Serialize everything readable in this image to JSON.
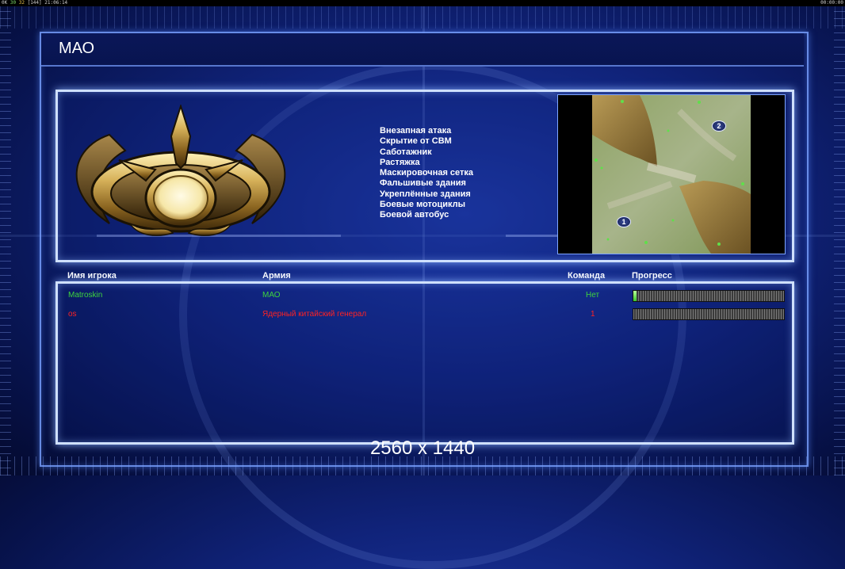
{
  "overlay": {
    "left_prefix": "0K",
    "left_green": "30",
    "left_yellow": "32",
    "left_gray": "[144]",
    "left_time": "21:06:14",
    "right_time": "00:00:00"
  },
  "header": {
    "title": "МАО"
  },
  "general": {
    "emblem": "gold-crest-emblem",
    "abilities": [
      "Внезапная атака",
      "Скрытие от СВМ",
      "Саботажник",
      "Растяжка",
      "Маскировочная сетка",
      "Фальшивые здания",
      "Укреплённые здания",
      "Боевые мотоциклы",
      "Боевой автобус"
    ]
  },
  "minimap": {
    "spawns": [
      {
        "label": "2"
      },
      {
        "label": "1"
      }
    ]
  },
  "table": {
    "headers": {
      "player": "Имя игрока",
      "army": "Армия",
      "team": "Команда",
      "progress": "Прогресс"
    },
    "rows": [
      {
        "name": "Matroskin",
        "army": "МАО",
        "team": "Нет",
        "progress": 0.02,
        "color": "#3ed43e"
      },
      {
        "name": "os",
        "army": "Ядерный китайский генерал",
        "team": "1",
        "progress": 0,
        "color": "#ff2222"
      }
    ]
  },
  "footer": {
    "resolution": "2560 x 1440"
  },
  "colors": {
    "accent": "#cfe0ff",
    "player1": "#3ed43e",
    "player2": "#ff2222"
  }
}
